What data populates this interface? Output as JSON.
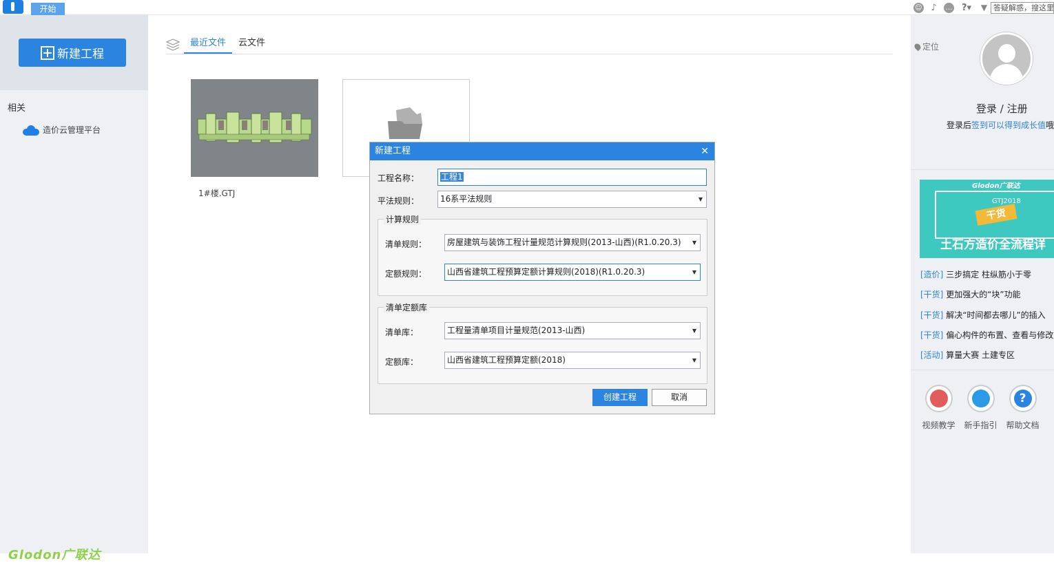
{
  "topbar": {
    "tab_start": "开始",
    "search_placeholder": "答疑解惑，搜这里"
  },
  "sidebar": {
    "new_project_label": "新建工程",
    "related_title": "相关",
    "cloud_platform_label": "造价云管理平台",
    "brand": "Glodon广联达"
  },
  "main": {
    "tabs": [
      {
        "label": "最近文件",
        "active": true
      },
      {
        "label": "云文件",
        "active": false
      }
    ],
    "recent_files": [
      {
        "name": "1#楼.GTJ"
      }
    ]
  },
  "dialog": {
    "title": "新建工程",
    "name_label": "工程名称：",
    "name_value": "工程1",
    "rule_label": "平法规则：",
    "rule_value": "16系平法规则",
    "calc_group_title": "计算规则",
    "bill_rule_label": "清单规则：",
    "bill_rule_value": "房屋建筑与装饰工程计量规范计算规则(2013-山西)(R1.0.20.3)",
    "quota_rule_label": "定额规则：",
    "quota_rule_value": "山西省建筑工程预算定额计算规则(2018)(R1.0.20.3)",
    "lib_group_title": "清单定额库",
    "bill_lib_label": "清单库：",
    "bill_lib_value": "工程量清单项目计量规范(2013-山西)",
    "quota_lib_label": "定额库：",
    "quota_lib_value": "山西省建筑工程预算定额(2018)",
    "create_button": "创建工程",
    "cancel_button": "取消"
  },
  "right_panel": {
    "location_label": "定位",
    "login_text": "登录 / 注册",
    "login_hint_prefix": "登录后",
    "login_hint_link": "签到可以得到成长值",
    "login_hint_suffix": "哦",
    "banner": {
      "brand": "Glodon广联达",
      "version": "GTJ2018",
      "tag": "干货",
      "headline": "土石方造价全流程详"
    },
    "news": [
      {
        "tag": "[造价]",
        "text": "三步搞定 柱纵筋小于零"
      },
      {
        "tag": "[干货]",
        "text": "更加强大的“块”功能"
      },
      {
        "tag": "[干货]",
        "text": "解决“时间都去哪儿”的插入"
      },
      {
        "tag": "[干货]",
        "text": "偏心构件的布置、查看与修改"
      },
      {
        "tag": "[活动]",
        "text": "算量大赛 土建专区"
      }
    ],
    "help": [
      {
        "label": "视频教学",
        "icon": "video-icon",
        "color": "#e45b5b"
      },
      {
        "label": "新手指引",
        "icon": "user-guide-icon",
        "color": "#2b9be8"
      },
      {
        "label": "帮助文档",
        "icon": "help-icon",
        "color": "#2b84e0"
      }
    ]
  }
}
